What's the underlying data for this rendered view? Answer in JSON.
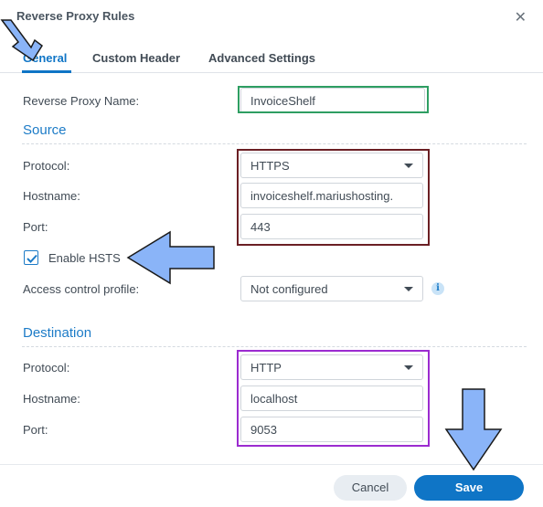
{
  "dialog": {
    "title": "Reverse Proxy Rules",
    "close_icon": "✕"
  },
  "tabs": [
    {
      "label": "General",
      "active": true
    },
    {
      "label": "Custom Header",
      "active": false
    },
    {
      "label": "Advanced Settings",
      "active": false
    }
  ],
  "general": {
    "name_label": "Reverse Proxy Name:",
    "name_value": "InvoiceShelf"
  },
  "source": {
    "heading": "Source",
    "protocol_label": "Protocol:",
    "protocol_value": "HTTPS",
    "hostname_label": "Hostname:",
    "hostname_value": "invoiceshelf.mariushosting.",
    "port_label": "Port:",
    "port_value": "443",
    "hsts_label": "Enable HSTS",
    "hsts_checked": true,
    "acp_label": "Access control profile:",
    "acp_value": "Not configured",
    "info_icon": "i"
  },
  "destination": {
    "heading": "Destination",
    "protocol_label": "Protocol:",
    "protocol_value": "HTTP",
    "hostname_label": "Hostname:",
    "hostname_value": "localhost",
    "port_label": "Port:",
    "port_value": "9053"
  },
  "footer": {
    "cancel_label": "Cancel",
    "save_label": "Save"
  },
  "annotations": {
    "name_box_color": "#2e9e62",
    "source_box_color": "#6b1f24",
    "destination_box_color": "#9b2bd0",
    "arrow_color": "#8ab4f8"
  }
}
